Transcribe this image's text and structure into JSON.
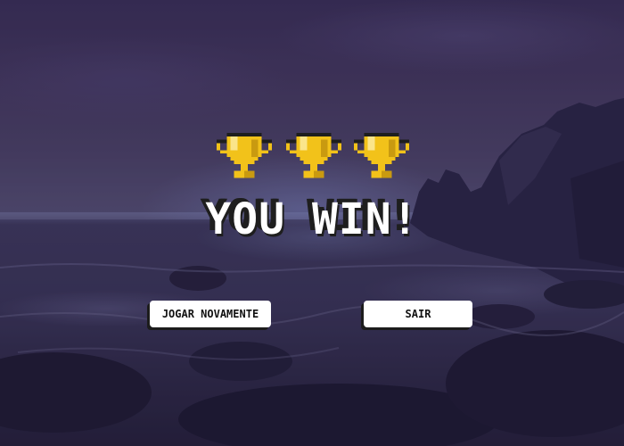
{
  "game": {
    "title": "YOU WIN!",
    "trophy_count": 3,
    "trophy_color": "#f2c21a"
  },
  "buttons": {
    "play_again_label": "JOGAR NOVAMENTE",
    "exit_label": "SAIR"
  }
}
